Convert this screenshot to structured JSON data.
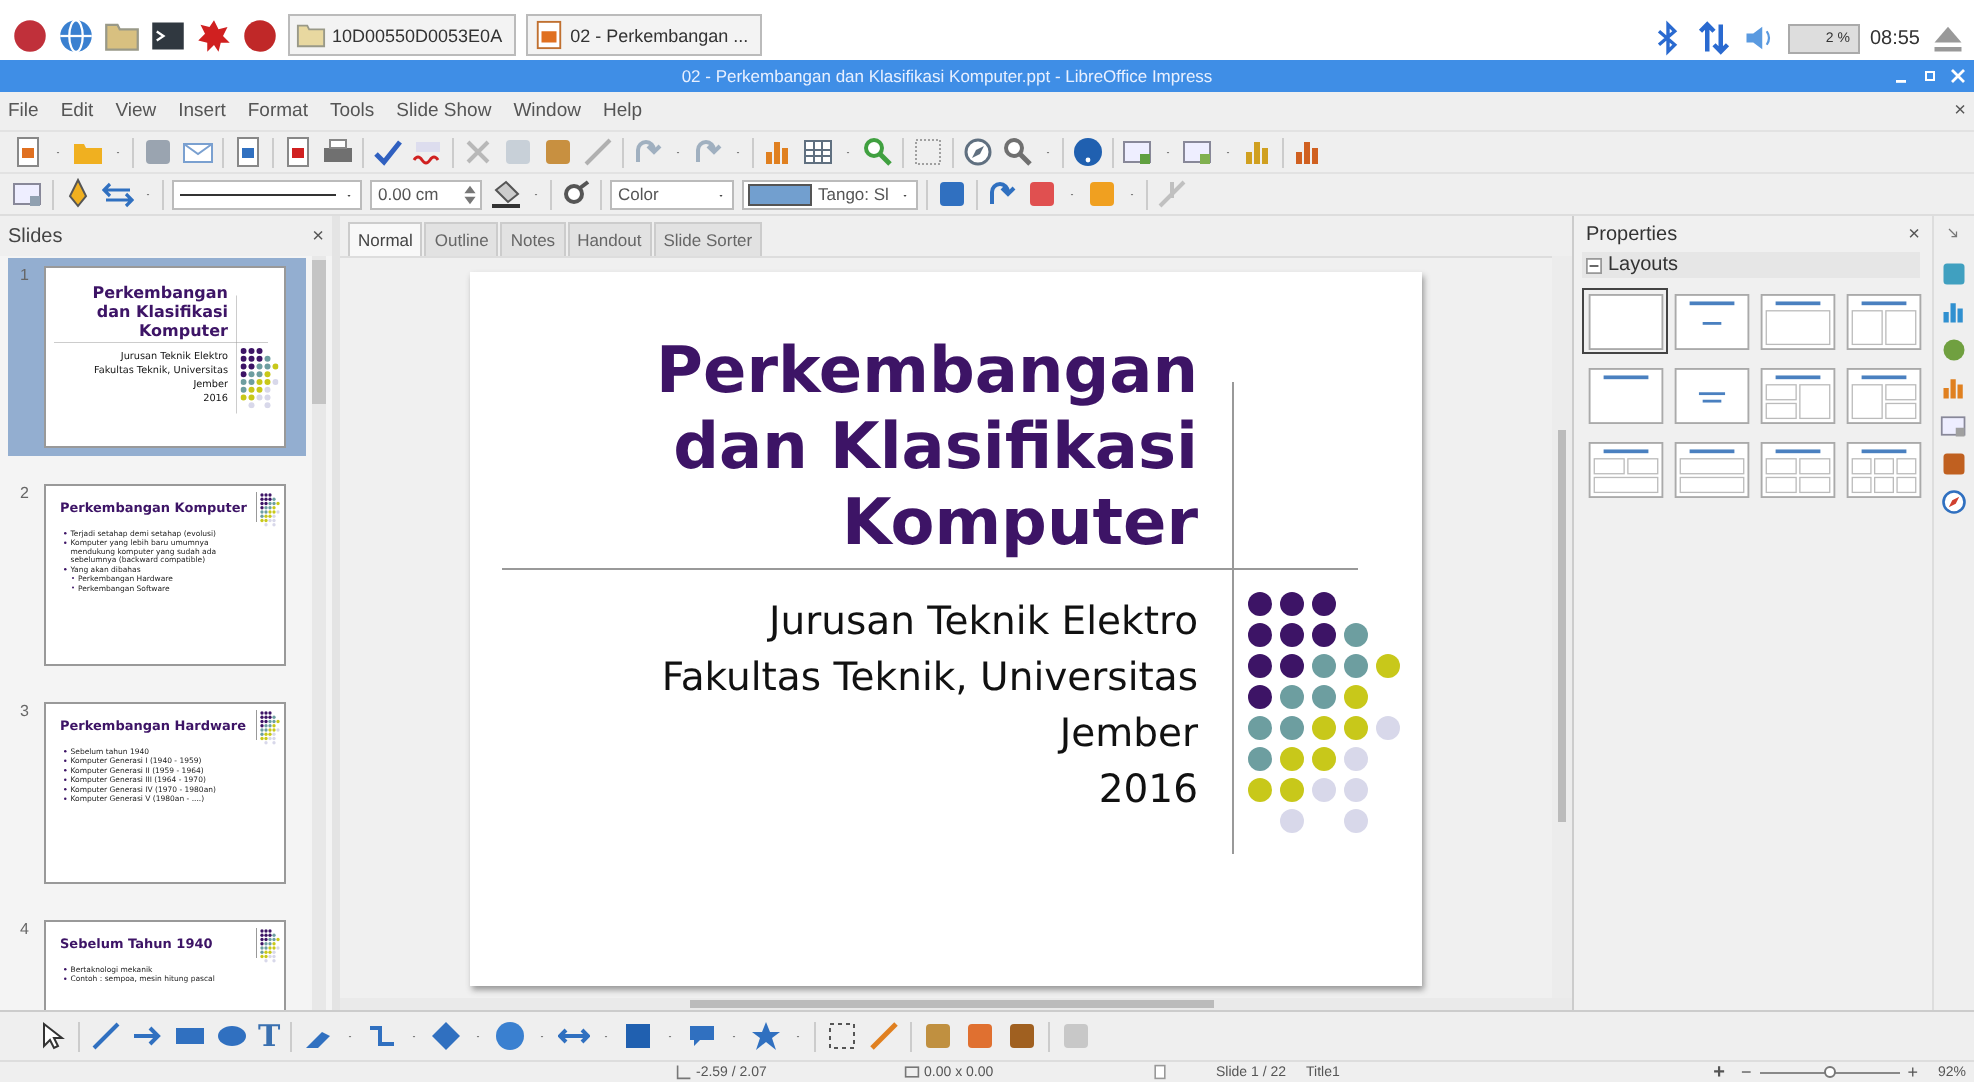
{
  "taskbar": {
    "tasks": [
      {
        "label": "10D00550D0053E0A",
        "kind": "folder"
      },
      {
        "label": "02 - Perkembangan ...",
        "kind": "impress"
      }
    ],
    "cpu": "2 %",
    "clock": "08:55"
  },
  "window": {
    "title": "02 - Perkembangan dan Klasifikasi Komputer.ppt - LibreOffice Impress"
  },
  "menu": {
    "items": [
      "File",
      "Edit",
      "View",
      "Insert",
      "Format",
      "Tools",
      "Slide Show",
      "Window",
      "Help"
    ],
    "close": "×"
  },
  "format_bar": {
    "line_width": "0.00 cm",
    "area_style": "Color",
    "area_color": "Tango: Sl"
  },
  "slides_panel": {
    "title": "Slides",
    "close": "×",
    "slides": [
      {
        "number": "1",
        "selected": true,
        "kind": "title",
        "title_lines": [
          "Perkembangan",
          "dan Klasifikasi",
          "Komputer"
        ],
        "subtitle_lines": [
          "Jurusan Teknik Elektro",
          "Fakultas Teknik, Universitas",
          "Jember",
          "2016"
        ]
      },
      {
        "number": "2",
        "selected": false,
        "kind": "bullets",
        "title": "Perkembangan Komputer",
        "bullets": [
          {
            "text": "Terjadi setahap demi setahap (evolusi)"
          },
          {
            "text": "Komputer yang lebih baru umumnya mendukung komputer yang sudah ada sebelumnya (backward compatible)"
          },
          {
            "text": "Yang akan dibahas",
            "children": [
              {
                "text": "Perkembangan Hardware"
              },
              {
                "text": "Perkembangan Software"
              }
            ]
          }
        ]
      },
      {
        "number": "3",
        "selected": false,
        "kind": "bullets",
        "title": "Perkembangan Hardware",
        "bullets": [
          {
            "text": "Sebelum tahun 1940"
          },
          {
            "text": "Komputer Generasi I (1940 - 1959)"
          },
          {
            "text": "Komputer Generasi II (1959 - 1964)"
          },
          {
            "text": "Komputer Generasi III (1964 - 1970)"
          },
          {
            "text": "Komputer Generasi IV (1970 - 1980an)"
          },
          {
            "text": "Komputer Generasi V (1980an - ....)"
          }
        ]
      },
      {
        "number": "4",
        "selected": false,
        "kind": "bullets",
        "title": "Sebelum Tahun 1940",
        "bullets": [
          {
            "text": "Bertaknologi mekanik"
          },
          {
            "text": "Contoh : sempoa, mesin hitung pascal"
          }
        ]
      }
    ]
  },
  "view_tabs": [
    {
      "label": "Normal",
      "selected": true
    },
    {
      "label": "Outline",
      "selected": false
    },
    {
      "label": "Notes",
      "selected": false
    },
    {
      "label": "Handout",
      "selected": false
    },
    {
      "label": "Slide Sorter",
      "selected": false
    }
  ],
  "slide": {
    "title_lines": [
      "Perkembangan",
      "dan Klasifikasi",
      "Komputer"
    ],
    "subtitle_lines": [
      "Jurusan Teknik Elektro",
      "Fakultas Teknik, Universitas",
      "Jember",
      "2016"
    ]
  },
  "properties": {
    "title": "Properties",
    "close": "×",
    "section": {
      "title": "Layouts",
      "expanded": true,
      "layouts": [
        {
          "kind": "blank",
          "selected": true
        },
        {
          "kind": "title-slide",
          "selected": false
        },
        {
          "kind": "title-content",
          "selected": false
        },
        {
          "kind": "title-two-content",
          "selected": false
        },
        {
          "kind": "title-only",
          "selected": false
        },
        {
          "kind": "centered-text",
          "selected": false
        },
        {
          "kind": "title-2content-and-content",
          "selected": false
        },
        {
          "kind": "title-content-and-2content",
          "selected": false
        },
        {
          "kind": "title-2content-over-content",
          "selected": false
        },
        {
          "kind": "title-content-over-content",
          "selected": false
        },
        {
          "kind": "title-4content",
          "selected": false
        },
        {
          "kind": "title-6content",
          "selected": false
        }
      ]
    }
  },
  "drawing_bar": {
    "text_tool": "T"
  },
  "status_bar": {
    "position": "-2.59 / 2.07",
    "size": "0.00 x 0.00",
    "slide": "Slide 1 / 22",
    "layout": "Title1",
    "fit": "+",
    "zoom_out": "−",
    "zoom_slider": {
      "level": 0.5
    },
    "zoom_in": "+",
    "zoom": "92%"
  }
}
